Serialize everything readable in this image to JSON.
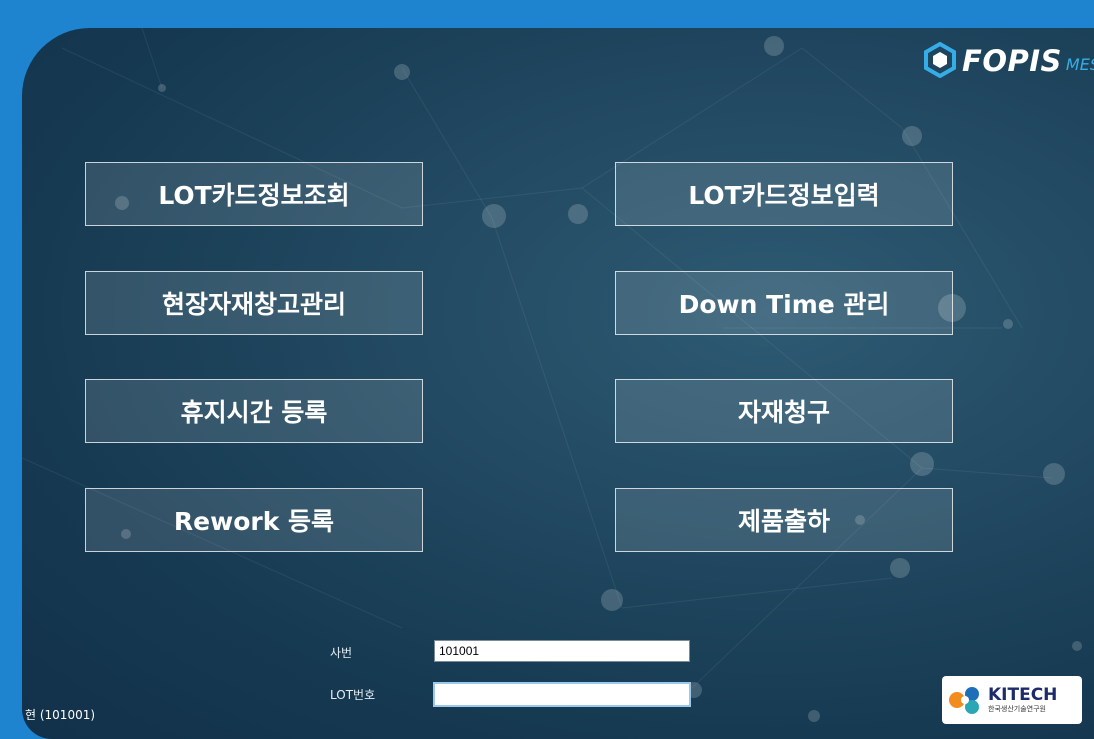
{
  "brand": {
    "name": "FOPIS",
    "suffix": "MES"
  },
  "menu": [
    {
      "label": "LOT카드정보조회"
    },
    {
      "label": "LOT카드정보입력"
    },
    {
      "label": "현장자재창고관리"
    },
    {
      "label": "Down Time 관리"
    },
    {
      "label": "휴지시간 등록"
    },
    {
      "label": "자재청구"
    },
    {
      "label": "Rework 등록"
    },
    {
      "label": "제품출하"
    }
  ],
  "form": {
    "employee_label": "사번",
    "employee_value": "101001",
    "lot_label": "LOT번호",
    "lot_value": ""
  },
  "user_info": "현 (101001)",
  "org_logo": {
    "name": "KITECH",
    "sub": "한국생산기술연구원"
  },
  "colors": {
    "outer_bg": "#1e84cf",
    "panel_bg": "#224a62",
    "accent": "#35aee8"
  }
}
